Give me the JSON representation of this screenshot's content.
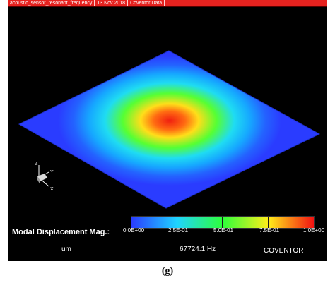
{
  "titlebar": {
    "items": [
      "acoustic_sensor_resonant_frequency",
      "13 Nov 2018",
      "Coventor Data"
    ]
  },
  "triad": {
    "z": "Z",
    "y": "Y",
    "x": "X"
  },
  "legend": {
    "title": "Modal Displacement Mag.:",
    "ticks": [
      "0.0E+00",
      "2.5E-01",
      "5.0E-01",
      "7.5E-01",
      "1.0E+00"
    ],
    "colors": [
      "#2a3cff",
      "#1fd4ff",
      "#2dff3a",
      "#ffee1a",
      "#f21212"
    ]
  },
  "unit": "um",
  "frequency": "67724.1 Hz",
  "brand": "COVENTOR",
  "caption": "(g)"
}
